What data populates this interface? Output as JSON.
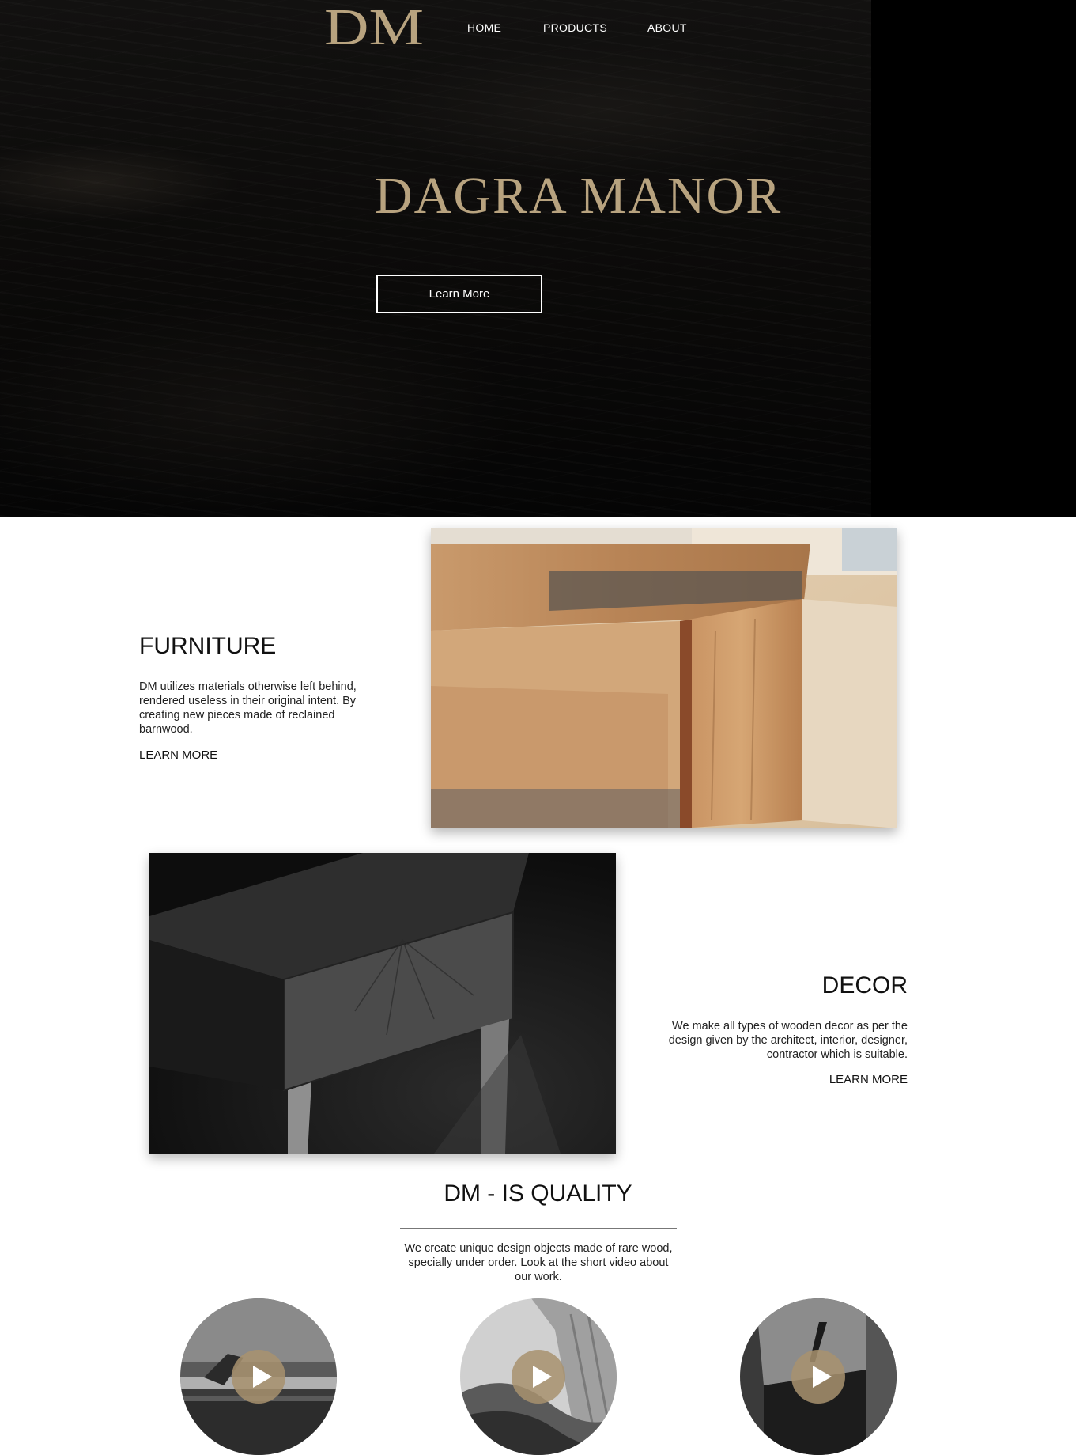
{
  "brand": {
    "logo_text": "DM",
    "accent_color": "#b8a37f"
  },
  "nav": {
    "items": [
      {
        "label": "HOME"
      },
      {
        "label": "PRODUCTS"
      },
      {
        "label": "ABOUT"
      }
    ]
  },
  "hero": {
    "title": "DAGRA MANOR",
    "button_label": "Learn More"
  },
  "furniture": {
    "title": "FURNITURE",
    "description": "DM utilizes materials otherwise left behind, rendered useless in their original intent. By creating new pieces made of reclained barnwood.",
    "link_label": "LEARN MORE"
  },
  "decor": {
    "title": "DECOR",
    "description": "We make all types of wooden decor as per the design given by the architect, interior, designer, contractor which is suitable.",
    "link_label": "LEARN MORE"
  },
  "quality": {
    "title": "DM - IS QUALITY",
    "description": "We create unique design objects made of rare wood, specially under order. Look at the short video about our work."
  },
  "videos": [
    {
      "icon": "play-icon"
    },
    {
      "icon": "play-icon"
    },
    {
      "icon": "play-icon"
    }
  ]
}
